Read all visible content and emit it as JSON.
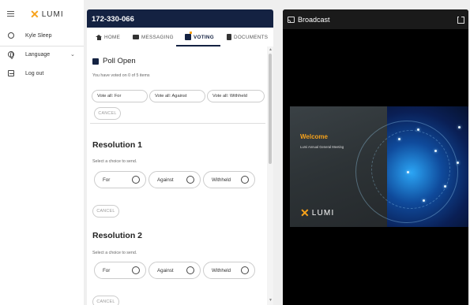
{
  "sidebar": {
    "logo_text": "LUMI",
    "user_name": "Kyle Sleep",
    "language_label": "Language",
    "logout_label": "Log out"
  },
  "voting_panel": {
    "meeting_id": "172-330-066",
    "tabs": [
      {
        "label": "HOME",
        "icon": "home-icon"
      },
      {
        "label": "MESSAGING",
        "icon": "messaging-icon"
      },
      {
        "label": "VOTING",
        "icon": "voting-icon",
        "active": true
      },
      {
        "label": "DOCUMENTS",
        "icon": "documents-icon"
      }
    ],
    "poll_title": "Poll Open",
    "voted_status": "You have voted on 0 of 5 items",
    "vote_all": {
      "for": "Vote all: For",
      "against": "Vote all: Against",
      "withheld": "Vote all: Withheld"
    },
    "cancel_label": "CANCEL",
    "resolutions": [
      {
        "title": "Resolution 1",
        "instruction": "Select a choice to send.",
        "choices": [
          "For",
          "Against",
          "Withheld"
        ],
        "cancel": "CANCEL"
      },
      {
        "title": "Resolution 2",
        "instruction": "Select a choice to send.",
        "choices": [
          "For",
          "Against",
          "Withheld"
        ],
        "cancel": "CANCEL"
      }
    ]
  },
  "broadcast": {
    "title": "Broadcast",
    "slide": {
      "heading": "Welcome",
      "subheading": "Lumi Annual General Meeting",
      "logo_text": "LUMI"
    }
  },
  "colors": {
    "brand_navy": "#142242",
    "brand_orange": "#f7a21b"
  }
}
